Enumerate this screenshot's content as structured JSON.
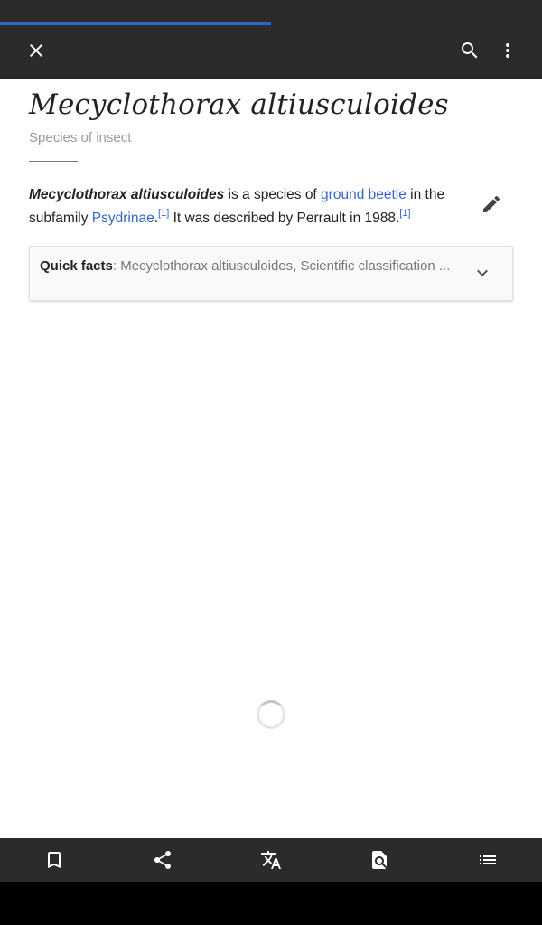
{
  "toolbar": {
    "progress_fraction": 0.5,
    "progress_color": "#3366cc",
    "icons": [
      "close-icon",
      "search-icon",
      "more-vert-icon"
    ]
  },
  "article": {
    "title": "Mecyclothorax altiusculoides",
    "description": "Species of insect",
    "lead": {
      "name": "Mecyclothorax altiusculoides",
      "text1": " is a species of ",
      "link1": "ground beetle",
      "text2": " in the subfamily ",
      "link2": "Psydrinae",
      "text3": ".",
      "ref1": "[1]",
      "text4": " It was described by Perrault in 1988.",
      "ref2": "[1]"
    },
    "edit_icon": "pencil-icon",
    "link_color": "#3366cc"
  },
  "quickfacts": {
    "label": "Quick facts",
    "text": ": Mecyclothorax altiusculoides, Scientific classification ...",
    "icon": "chevron-down-icon"
  },
  "loading": {
    "icon": "spinner-icon"
  },
  "bottom_bar": {
    "icons": [
      "bookmark-icon",
      "share-icon",
      "translate-icon",
      "find-in-page-icon",
      "contents-list-icon"
    ]
  }
}
